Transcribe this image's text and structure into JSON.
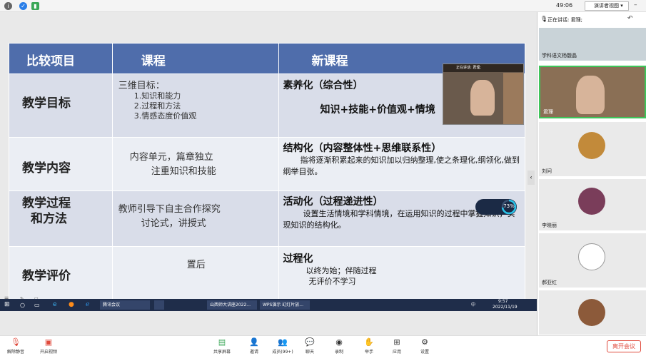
{
  "topbar": {
    "timer": "49:06",
    "view_mode": "演讲者视图"
  },
  "slide": {
    "headers": [
      "比较项目",
      "课程",
      "新课程"
    ],
    "rows": [
      {
        "label": "教学目标",
        "middle_title": "三维目标：",
        "middle_items": [
          "1.知识和能力",
          "2.过程和方法",
          "3.情感态度价值观"
        ],
        "right_title": "素养化（综合性）",
        "right_text": "知识+技能+价值观+情境"
      },
      {
        "label": "教学内容",
        "middle_lines": [
          "内容单元，篇章独立",
          "注重知识和技能"
        ],
        "right_title": "结构化（内容整体性+思维联系性）",
        "right_text": "指将逐渐积累起来的知识加以归纳整理,使之条理化,纲领化,做到纲举目张。"
      },
      {
        "label_lines": [
          "教学过程",
          "和方法"
        ],
        "middle_lines": [
          "教师引导下自主合作探究",
          "讨论式，讲授式"
        ],
        "right_title": "活动化（过程递进性）",
        "right_text": "设置生活情境和学科情境，在运用知识的过程中掌握知识，实现知识的结构化。"
      },
      {
        "label": "教学评价",
        "middle_text": "置后",
        "right_title": "过程化",
        "right_lines": [
          "以终为始；伴随过程",
          "无评价不学习"
        ]
      }
    ]
  },
  "overlay": {
    "speaking_label": "正在讲话: 君理;",
    "progress_percent": 73,
    "progress_label": "73%"
  },
  "taskbar": {
    "apps": [
      "腾讯会议",
      "山西师大讲座2022...",
      "WPS演示 幻灯片放..."
    ],
    "time": "9:57",
    "date": "2022/11/19",
    "lang": "中"
  },
  "sidebar": {
    "speaking": "正在讲话: 君理;",
    "participants": [
      {
        "name": "学科语文杨馥晶"
      },
      {
        "name": "君理"
      },
      {
        "name": "刘问"
      },
      {
        "name": "李晓丽"
      },
      {
        "name": "郝亚红"
      },
      {
        "name": ""
      }
    ]
  },
  "bottombar": {
    "buttons": [
      {
        "label": "解除静音",
        "icon": "mic-muted-icon"
      },
      {
        "label": "开启视频",
        "icon": "video-off-icon"
      },
      {
        "label": "共享屏幕",
        "icon": "share-screen-icon"
      },
      {
        "label": "邀请",
        "icon": "invite-icon"
      },
      {
        "label": "成员(99+)",
        "icon": "members-icon"
      },
      {
        "label": "聊天",
        "icon": "chat-icon"
      },
      {
        "label": "录制",
        "icon": "record-icon"
      },
      {
        "label": "举手",
        "icon": "raise-hand-icon"
      },
      {
        "label": "应用",
        "icon": "apps-icon"
      },
      {
        "label": "设置",
        "icon": "settings-icon"
      }
    ],
    "leave": "离开会议"
  },
  "colors": {
    "header_blue": "#4f6dab",
    "row_a": "#d9dde9",
    "row_b": "#ebeef4",
    "leave_red": "#e04a3c",
    "taskbar": "#1f2d4a"
  }
}
